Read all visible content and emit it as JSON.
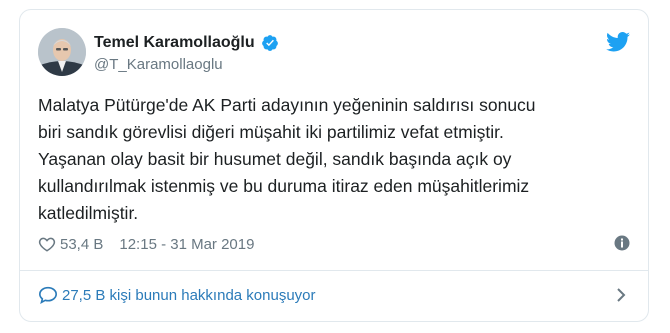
{
  "author": {
    "display_name": "Temel Karamollaoğlu",
    "handle": "@T_Karamollaoglu",
    "verified": true
  },
  "tweet": {
    "text": "Malatya Pütürge'de AK Parti adayının yeğeninin saldırısı sonucu\nbiri sandık görevlisi diğeri müşahit iki partilimiz vefat etmiştir.\nYaşanan olay basit bir husumet değil, sandık başında açık oy\nkullandırılmak istenmiş ve bu duruma itiraz eden müşahitlerimiz\nkatledilmiştir.",
    "likes": "53,4 B",
    "timestamp": "12:15 - 31 Mar 2019"
  },
  "footer": {
    "conversation_label": "27,5 B kişi bunun hakkında konuşuyor"
  },
  "icons": {
    "verified": "verified-badge-icon",
    "logo": "twitter-bird-icon",
    "like": "heart-icon",
    "info": "info-icon",
    "reply": "speech-bubble-icon",
    "chevron": "chevron-right-icon"
  },
  "colors": {
    "link_blue": "#2b7bb9",
    "twitter_blue": "#1da1f2",
    "muted_gray": "#697882",
    "border": "#e1e8ed"
  }
}
